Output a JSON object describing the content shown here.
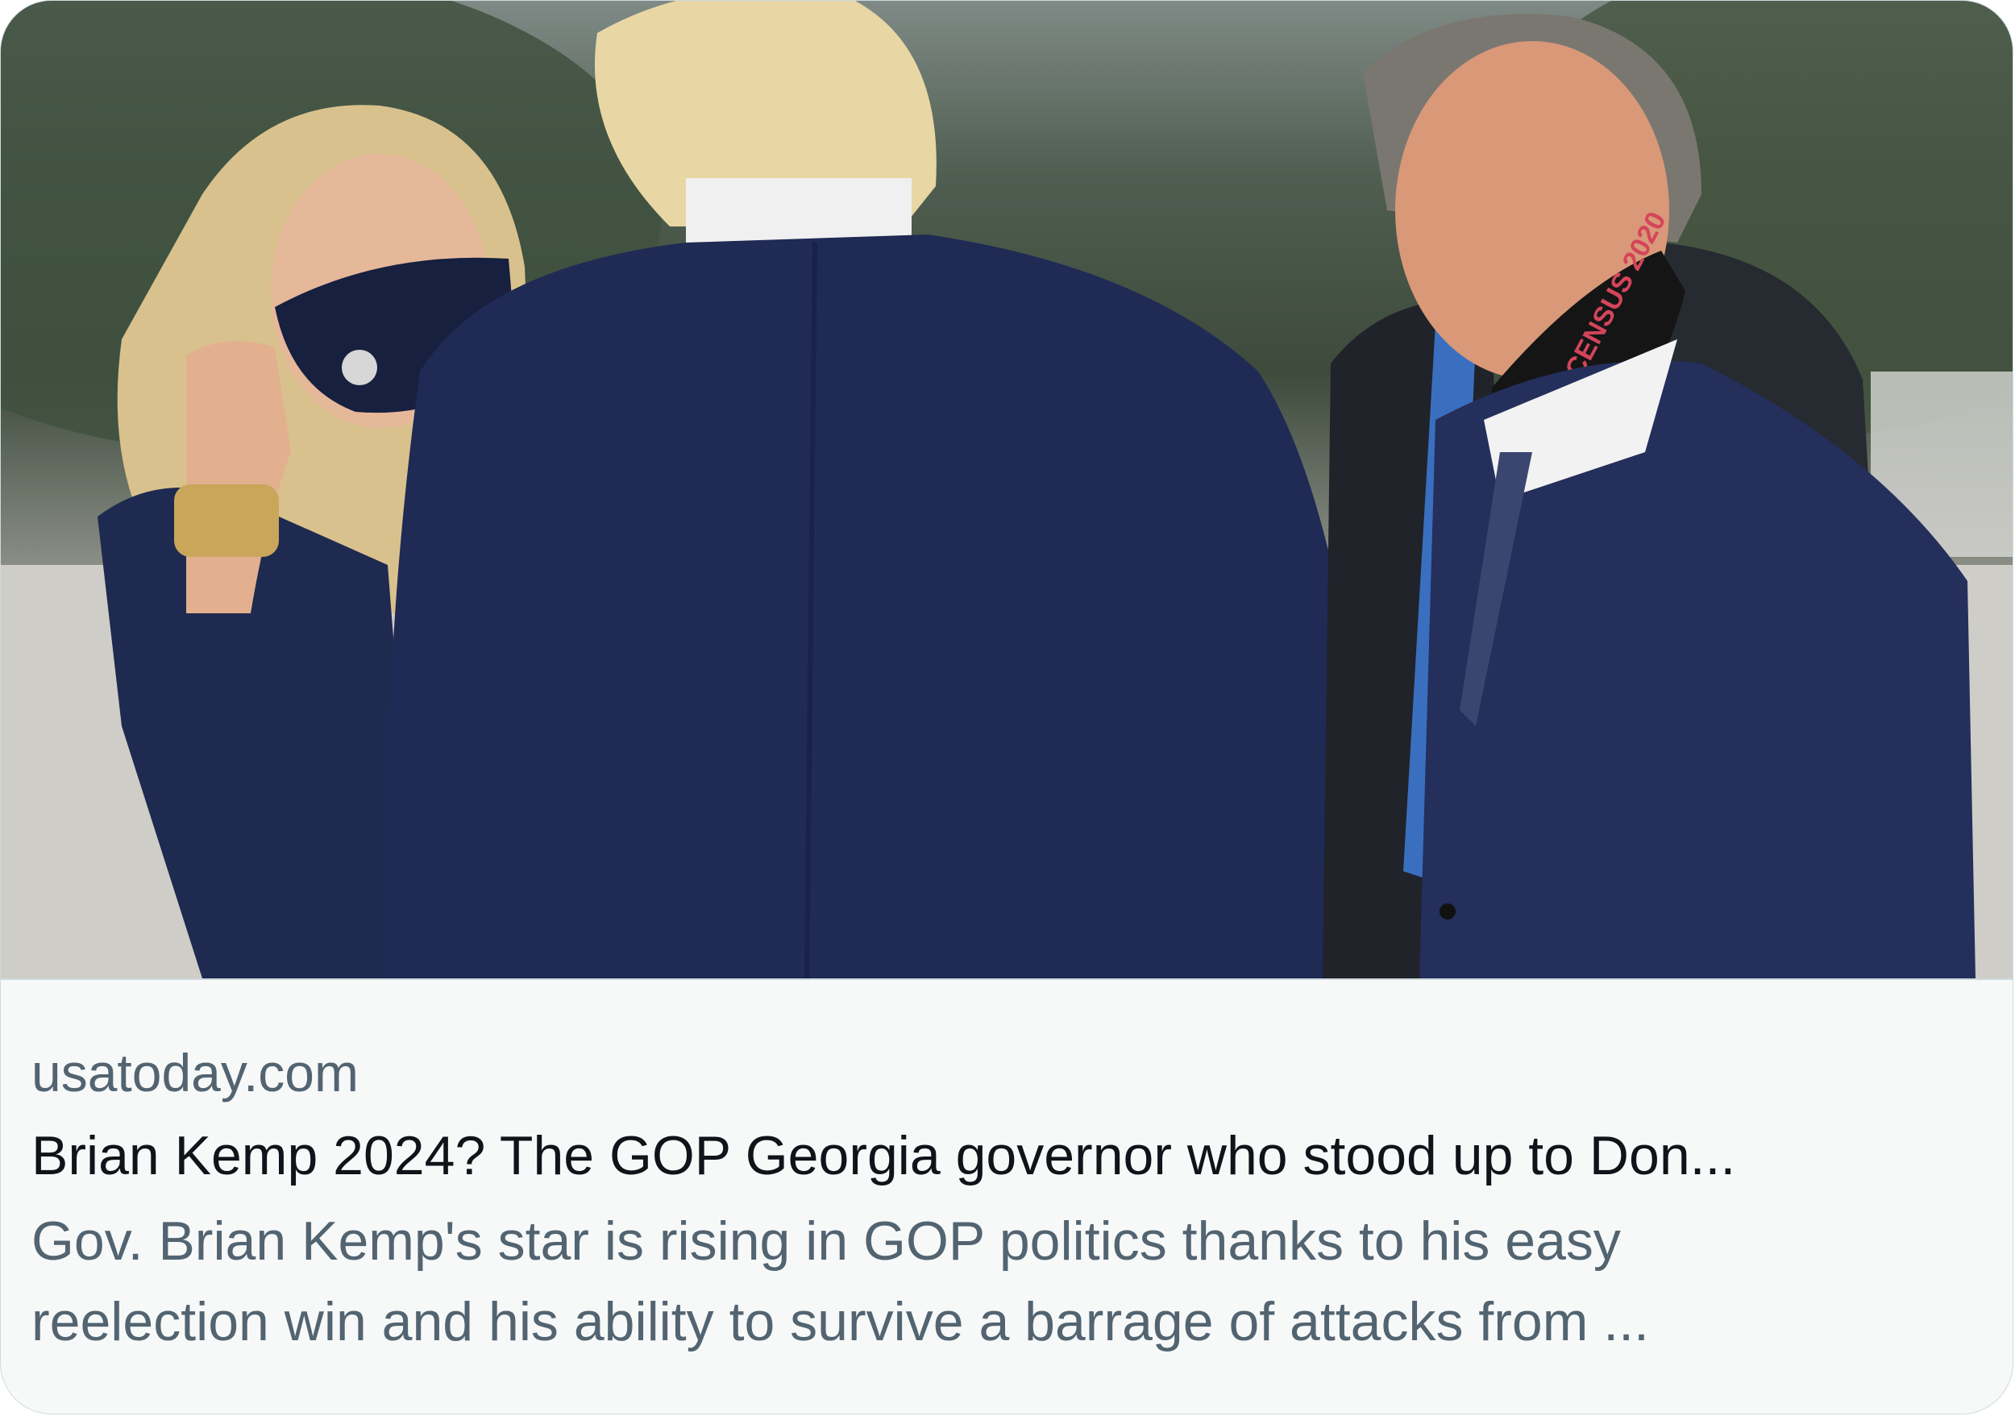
{
  "link_card": {
    "domain": "usatoday.com",
    "title": "Brian Kemp 2024? The GOP Georgia governor who stood up to Don...",
    "description": "Gov. Brian Kemp's star is rising in GOP politics thanks to his easy\nreelection win and his ability to survive a barrage of attacks from ...",
    "image_mask_text": "CENSUS 2020"
  },
  "colors": {
    "card_background": "#f7f9f9",
    "card_border": "#cfd9de",
    "title_text": "#0f1419",
    "secondary_text": "#536471",
    "suit_navy": "#1f2a55"
  }
}
